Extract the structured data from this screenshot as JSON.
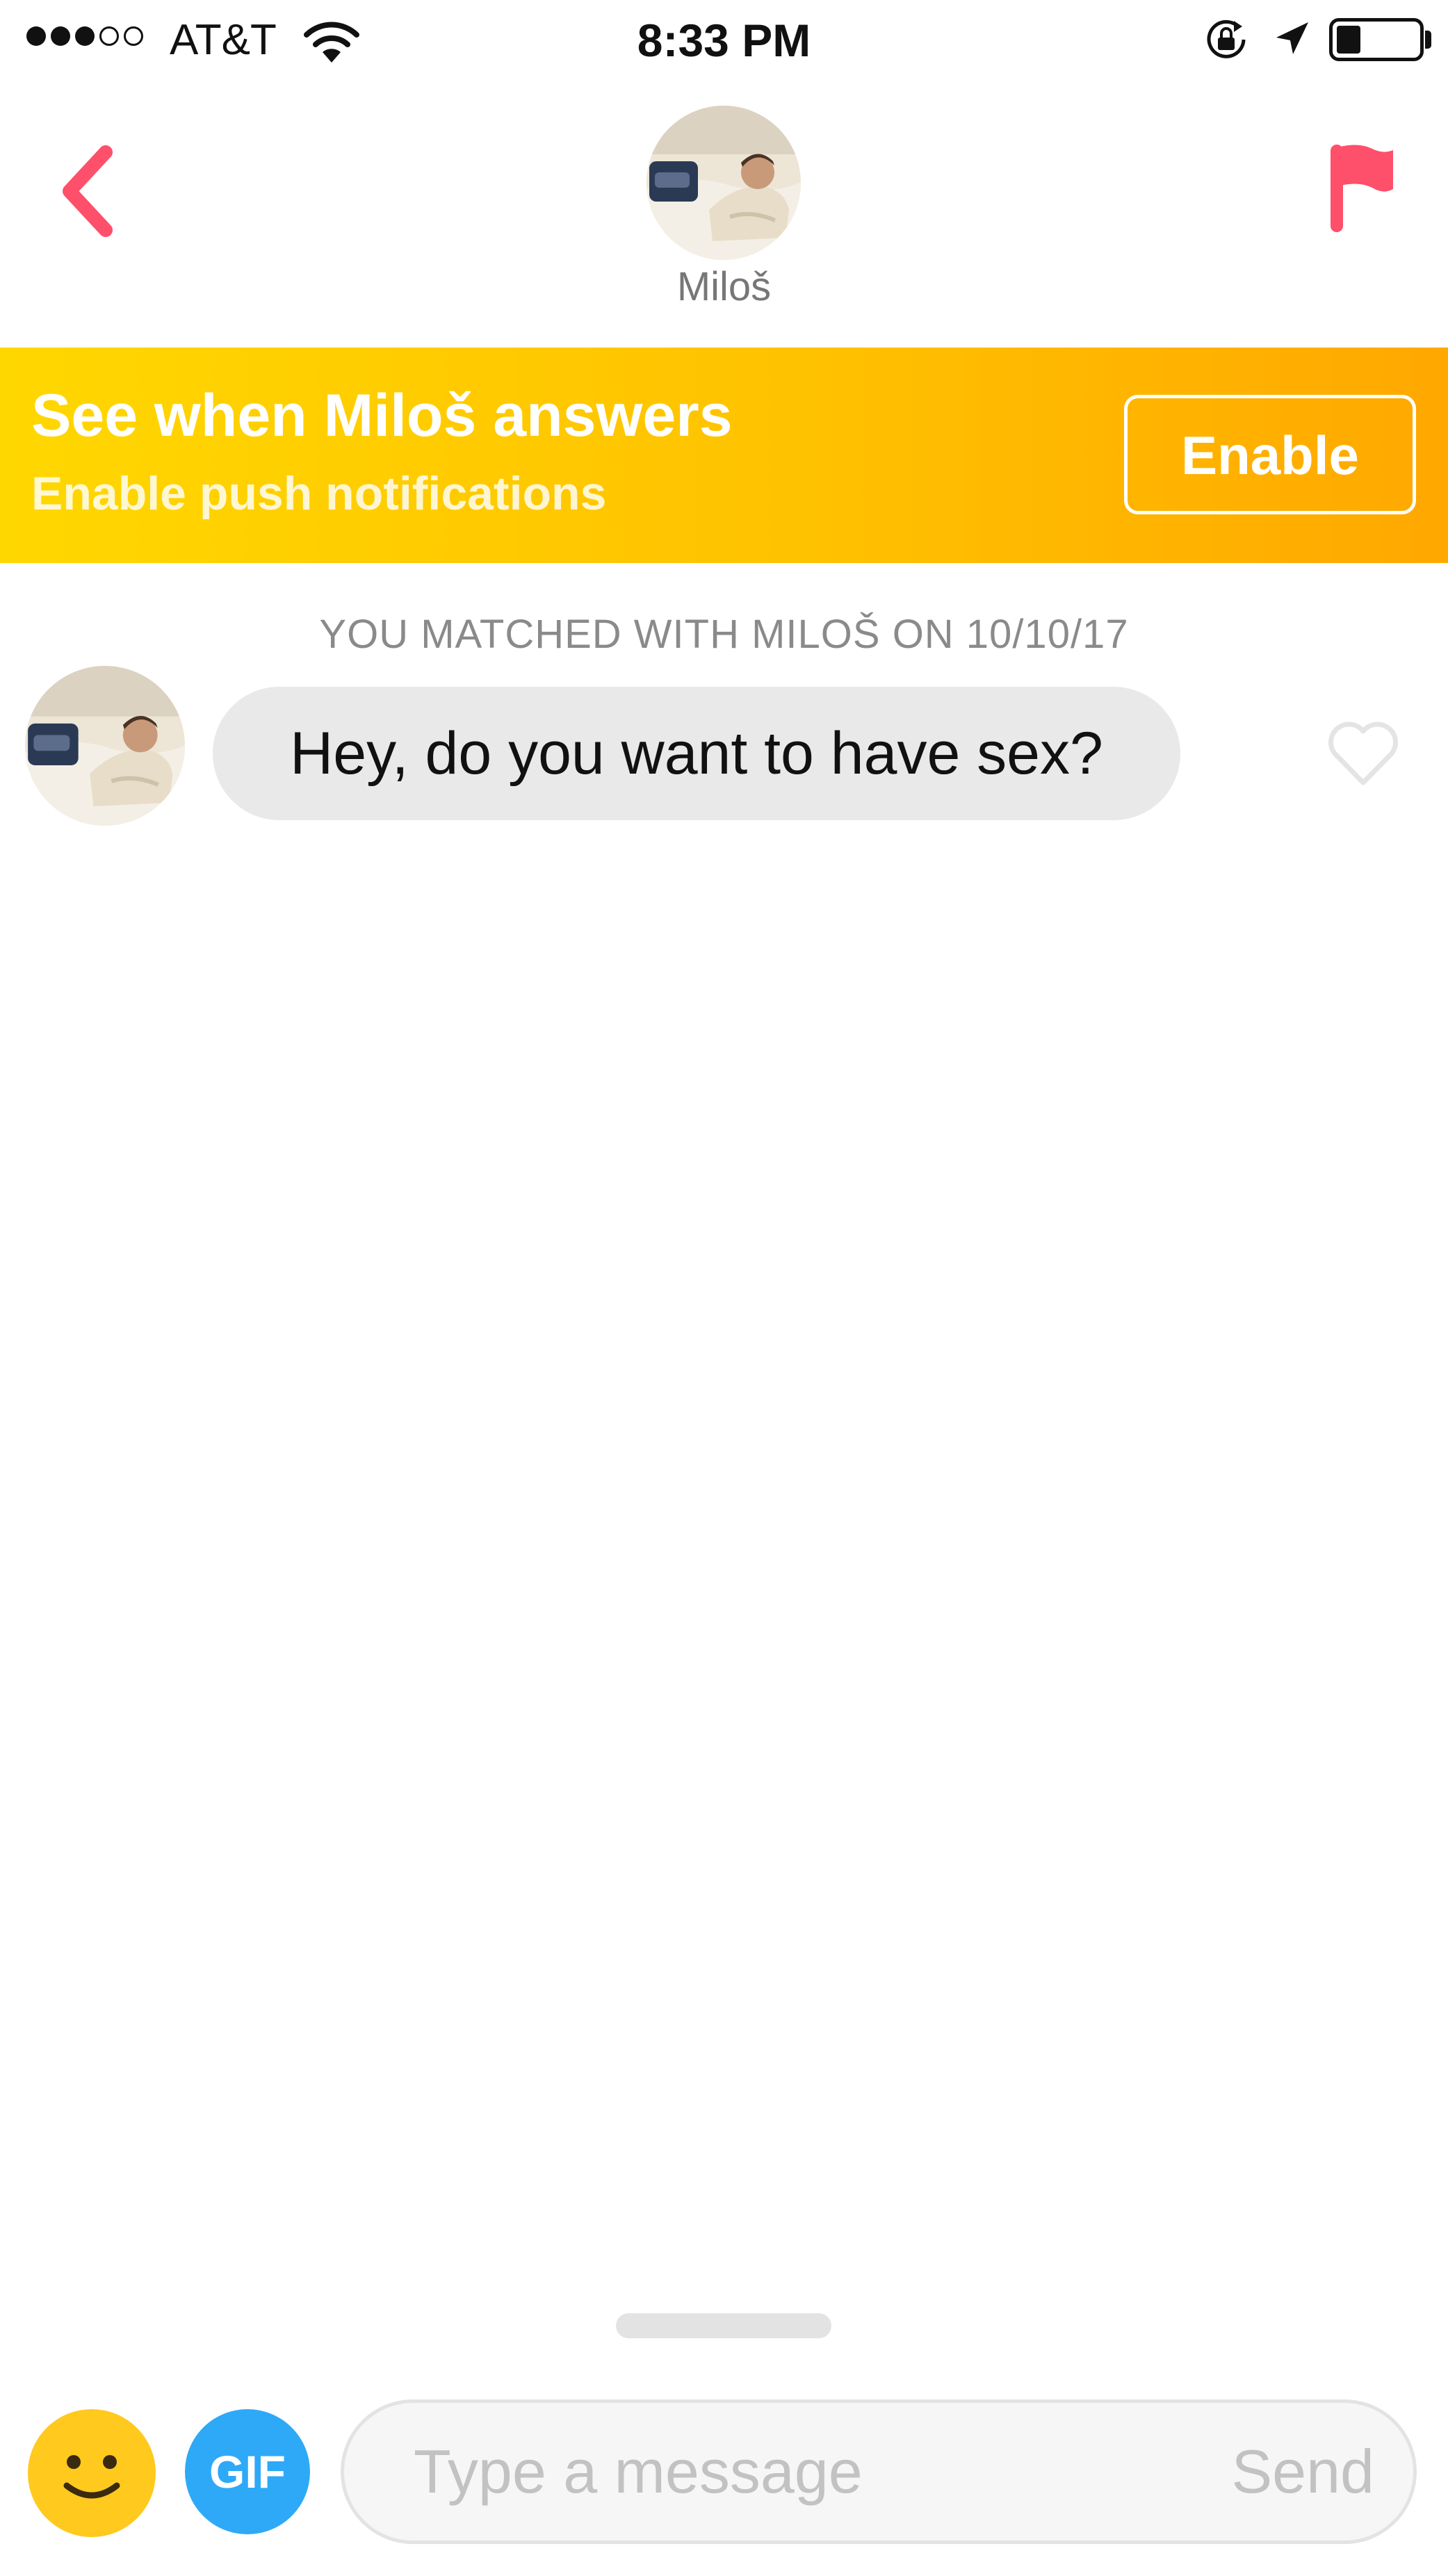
{
  "status_bar": {
    "carrier": "AT&T",
    "time": "8:33 PM",
    "signal_bars_filled": 3,
    "signal_bars_total": 5,
    "battery_level": 0.25
  },
  "header": {
    "back_icon": "chevron-left-icon",
    "match_name": "Miloš",
    "report_icon": "flag-icon"
  },
  "banner": {
    "title": "See when Miloš answers",
    "subtitle": "Enable push notifications",
    "button_label": "Enable"
  },
  "chat": {
    "match_notice": "YOU MATCHED WITH MILOŠ ON 10/10/17",
    "messages": [
      {
        "text": "Hey, do you want to have sex?",
        "liked": false
      }
    ]
  },
  "composer": {
    "emoji_icon": "smiley-icon",
    "gif_label": "GIF",
    "placeholder": "Type a message",
    "send_label": "Send"
  },
  "colors": {
    "accent_red": "#fe4f6b",
    "banner_start": "#ffd700",
    "banner_end": "#ffa800",
    "gif_blue": "#2ea9f8",
    "emoji_yellow": "#ffc91e"
  }
}
